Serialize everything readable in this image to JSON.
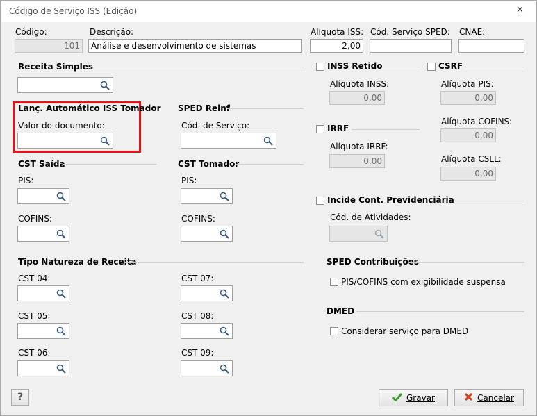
{
  "window": {
    "title": "Código de Serviço ISS (Edição)"
  },
  "fields": {
    "codigo": {
      "label": "Código:",
      "value": "101"
    },
    "descricao": {
      "label": "Descrição:",
      "value": "Análise e desenvolvimento de sistemas"
    },
    "aliquota_iss": {
      "label": "Alíquota ISS:",
      "value": "2,00"
    },
    "cod_servico_sped": {
      "label": "Cód. Serviço SPED:",
      "value": ""
    },
    "cnae": {
      "label": "CNAE:",
      "value": ""
    }
  },
  "receita_simples": {
    "header": "Receita Simples"
  },
  "lanc_automatico": {
    "header": "Lanç. Automático ISS Tomador",
    "valor_label": "Valor do documento:"
  },
  "sped_reinf": {
    "header": "SPED Reinf",
    "cod_servico_label": "Cód. de Serviço:"
  },
  "cst_saida": {
    "header": "CST Saída",
    "pis_label": "PIS:",
    "cofins_label": "COFINS:"
  },
  "cst_tomador": {
    "header": "CST Tomador",
    "pis_label": "PIS:",
    "cofins_label": "COFINS:"
  },
  "tipo_natureza": {
    "header": "Tipo Natureza de Receita",
    "left": [
      "CST 04:",
      "CST 05:",
      "CST 06:"
    ],
    "right": [
      "CST 07:",
      "CST 08:",
      "CST 09:"
    ]
  },
  "inss": {
    "header": "INSS Retido",
    "checked": false,
    "aliquota_label": "Alíquota INSS:",
    "aliquota_value": "0,00"
  },
  "irrf": {
    "header": "IRRF",
    "checked": false,
    "aliquota_label": "Alíquota IRRF:",
    "aliquota_value": "0,00"
  },
  "csrf": {
    "header": "CSRF",
    "checked": false,
    "pis_label": "Alíquota PIS:",
    "pis_value": "0,00",
    "cofins_label": "Alíquota COFINS:",
    "cofins_value": "0,00",
    "csll_label": "Alíquota CSLL:",
    "csll_value": "0,00"
  },
  "previdenciaria": {
    "header": "Incide Cont. Previdenciária",
    "checked": false,
    "atividades_label": "Cód. de Atividades:"
  },
  "sped_contribuicoes": {
    "header": "SPED Contribuições",
    "option_label": "PIS/COFINS com exigibilidade suspensa",
    "checked": false
  },
  "dmed": {
    "header": "DMED",
    "option_label": "Considerar serviço para DMED",
    "checked": false
  },
  "buttons": {
    "help": "?",
    "gravar": "Gravar",
    "cancelar": "Cancelar"
  },
  "colors": {
    "highlight_border": "#e0151b",
    "gravar_icon": "#3a9a2e",
    "cancelar_icon": "#d93b20"
  }
}
